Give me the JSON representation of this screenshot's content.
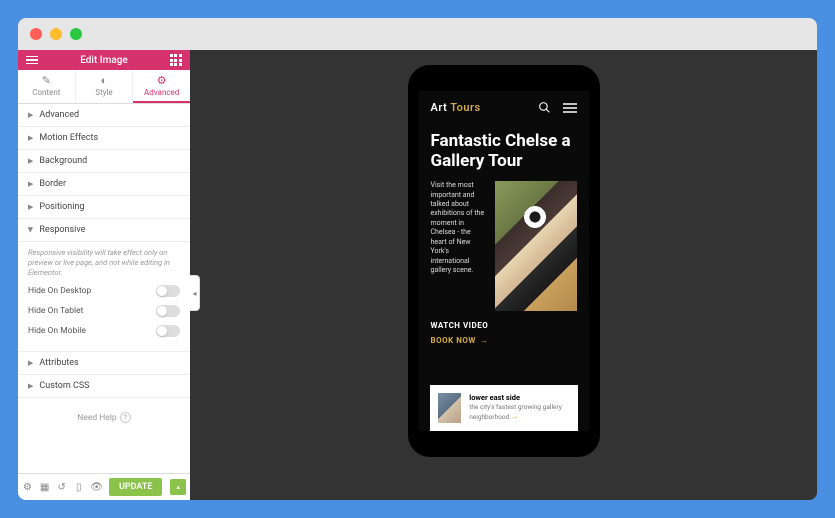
{
  "header": {
    "title": "Edit Image"
  },
  "tabs": [
    {
      "icon": "✎",
      "label": "Content"
    },
    {
      "icon": "◐",
      "label": "Style"
    },
    {
      "icon": "⚙",
      "label": "Advanced",
      "active": true
    }
  ],
  "sections": [
    {
      "label": "Advanced"
    },
    {
      "label": "Motion Effects"
    },
    {
      "label": "Background"
    },
    {
      "label": "Border"
    },
    {
      "label": "Positioning"
    }
  ],
  "responsive": {
    "label": "Responsive",
    "note": "Responsive visibility will take effect only on preview or live page, and not while editing in Elementor.",
    "toggles": [
      {
        "label": "Hide On Desktop"
      },
      {
        "label": "Hide On Tablet"
      },
      {
        "label": "Hide On Mobile"
      }
    ]
  },
  "sections_after": [
    {
      "label": "Attributes"
    },
    {
      "label": "Custom CSS"
    }
  ],
  "help": {
    "text": "Need Help"
  },
  "footer": {
    "update": "UPDATE"
  },
  "preview": {
    "logo_a": "Art",
    "logo_b": "Tours",
    "hero": "Fantastic Chelse a Gallery Tour",
    "desc": "Visit the most important and talked about exhibitions of the moment in Chelsea - the heart of New York's international gallery scene.",
    "watch": "WATCH VIDEO",
    "book": "BOOK NOW",
    "card_title": "lower east side",
    "card_desc": "the city's fastest growing gallery neighborhood"
  }
}
